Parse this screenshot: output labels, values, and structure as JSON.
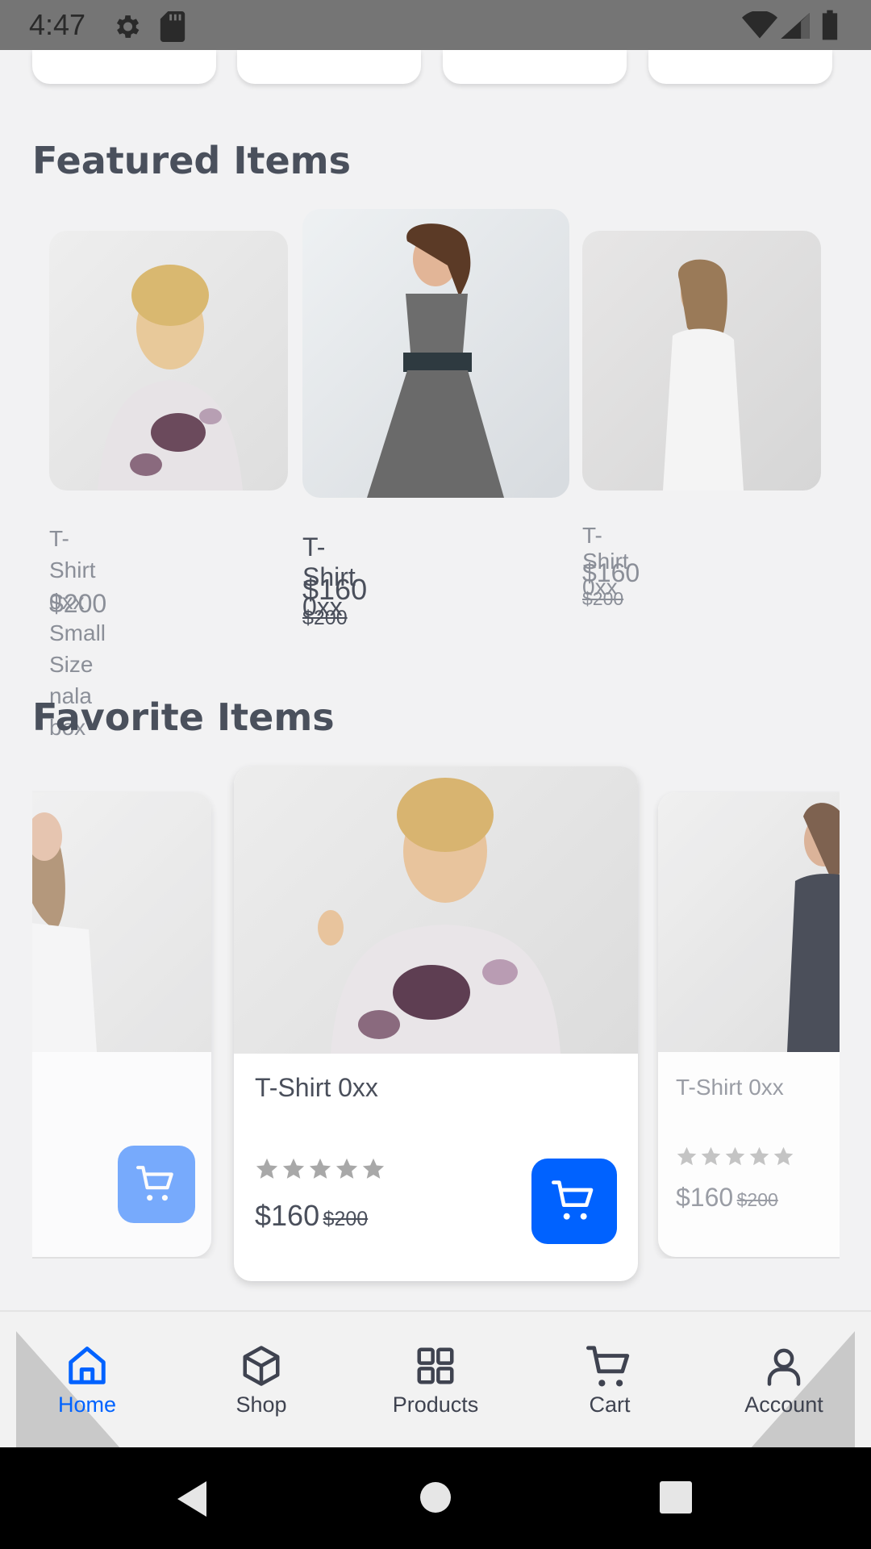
{
  "status_bar": {
    "time": "4:47"
  },
  "sections": {
    "featured_title": "Featured Items",
    "favorite_title": "Favorite Items"
  },
  "featured": [
    {
      "name_line1": "T-Shirt 0xx Small Size",
      "name_line2": "nala box",
      "price": "$200"
    },
    {
      "name": "T-Shirt 0xx",
      "price": "$160",
      "old_price": "$200"
    },
    {
      "name": "T-Shirt 0xx",
      "price": "$160",
      "old_price": "$200"
    }
  ],
  "favorites": [
    {
      "name": ""
    },
    {
      "name": "T-Shirt 0xx",
      "price": "$160",
      "old_price": "$200",
      "rating": 5
    },
    {
      "name": "T-Shirt 0xx",
      "price": "$160",
      "old_price": "$200",
      "rating": 5
    }
  ],
  "nav": {
    "active": "Home",
    "items": [
      {
        "label": "Home",
        "icon": "home-icon"
      },
      {
        "label": "Shop",
        "icon": "box-icon"
      },
      {
        "label": "Products",
        "icon": "grid-icon"
      },
      {
        "label": "Cart",
        "icon": "cart-icon"
      },
      {
        "label": "Account",
        "icon": "user-icon"
      }
    ]
  },
  "colors": {
    "accent": "#0062ff",
    "accent_faded": "#4f93ff",
    "title": "#4a505c",
    "star": "#a8a8a8"
  }
}
